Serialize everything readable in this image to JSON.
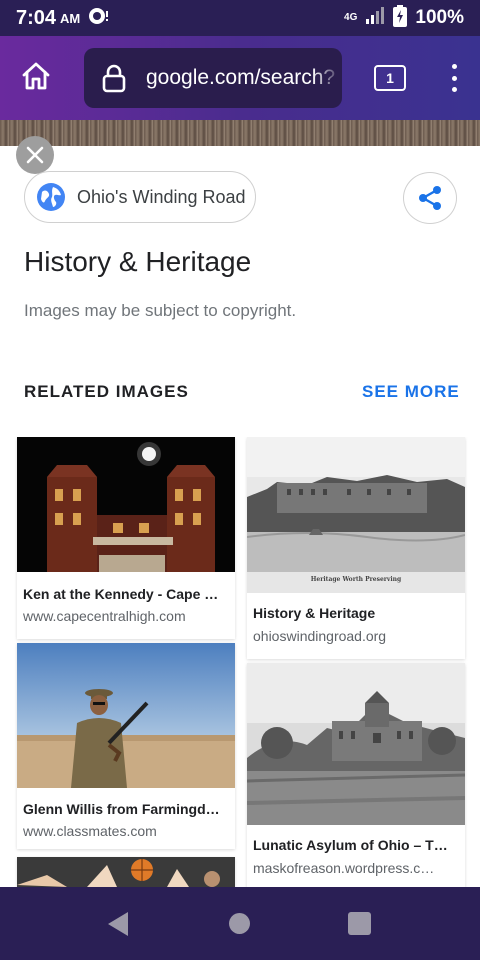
{
  "status": {
    "time": "7:04",
    "ampm": "AM",
    "network": "4G",
    "battery": "100%"
  },
  "browser": {
    "url": "google.com/search?",
    "tab_count": "1"
  },
  "detail": {
    "source_name": "Ohio's Winding Road",
    "title": "History & Heritage",
    "copyright": "Images may be subject to copyright."
  },
  "related": {
    "heading": "RELATED IMAGES",
    "see_more": "SEE MORE",
    "items": [
      {
        "title": "Ken at the Kennedy - Cape …",
        "source": "www.capecentralhigh.com"
      },
      {
        "title": "History & Heritage",
        "source": "ohioswindingroad.org",
        "caption": "Heritage Worth Preserving"
      },
      {
        "title": "Glenn Willis from Farmingd…",
        "source": "www.classmates.com"
      },
      {
        "title": "Lunatic Asylum of Ohio – T…",
        "source": "maskofreason.wordpress.c…"
      },
      {
        "title": "",
        "source": ""
      }
    ]
  },
  "colors": {
    "status_bar": "#2a1f55",
    "accent_link": "#1a73e8",
    "toolbar_start": "#6a2a9e",
    "toolbar_end": "#3a3290"
  }
}
